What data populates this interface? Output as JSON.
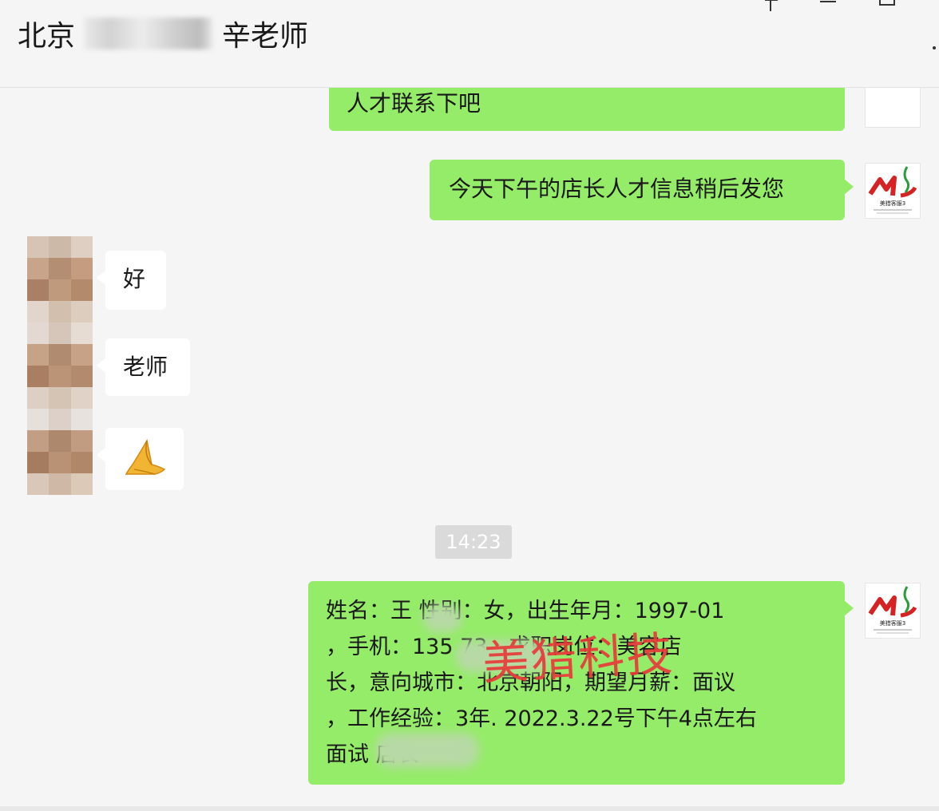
{
  "window": {
    "title_prefix": "北京",
    "title_suffix": "辛老师"
  },
  "messages": {
    "m1": "人才联系下吧",
    "m2": "今天下午的店长人才信息稍后发您",
    "m3": "好",
    "m4": "老师",
    "m5": "🙏",
    "m6_lines": [
      "姓名：王     性别：女，出生年月：1997-01",
      "，手机：135         73，求职岗位：美容店",
      "长，意向城市：北京朝阳，期望月薪：面议",
      "，工作经验：3年. 2022.3.22号下午4点左右",
      "面试              店长"
    ]
  },
  "timestamp": "14:23",
  "watermark": "美猎科技",
  "avatar": {
    "logo_caption": "美猎客服3"
  },
  "colors": {
    "outgoing_bubble": "#95ec69",
    "incoming_bubble": "#ffffff",
    "background": "#f5f5f5",
    "watermark": "#e83a3a"
  }
}
